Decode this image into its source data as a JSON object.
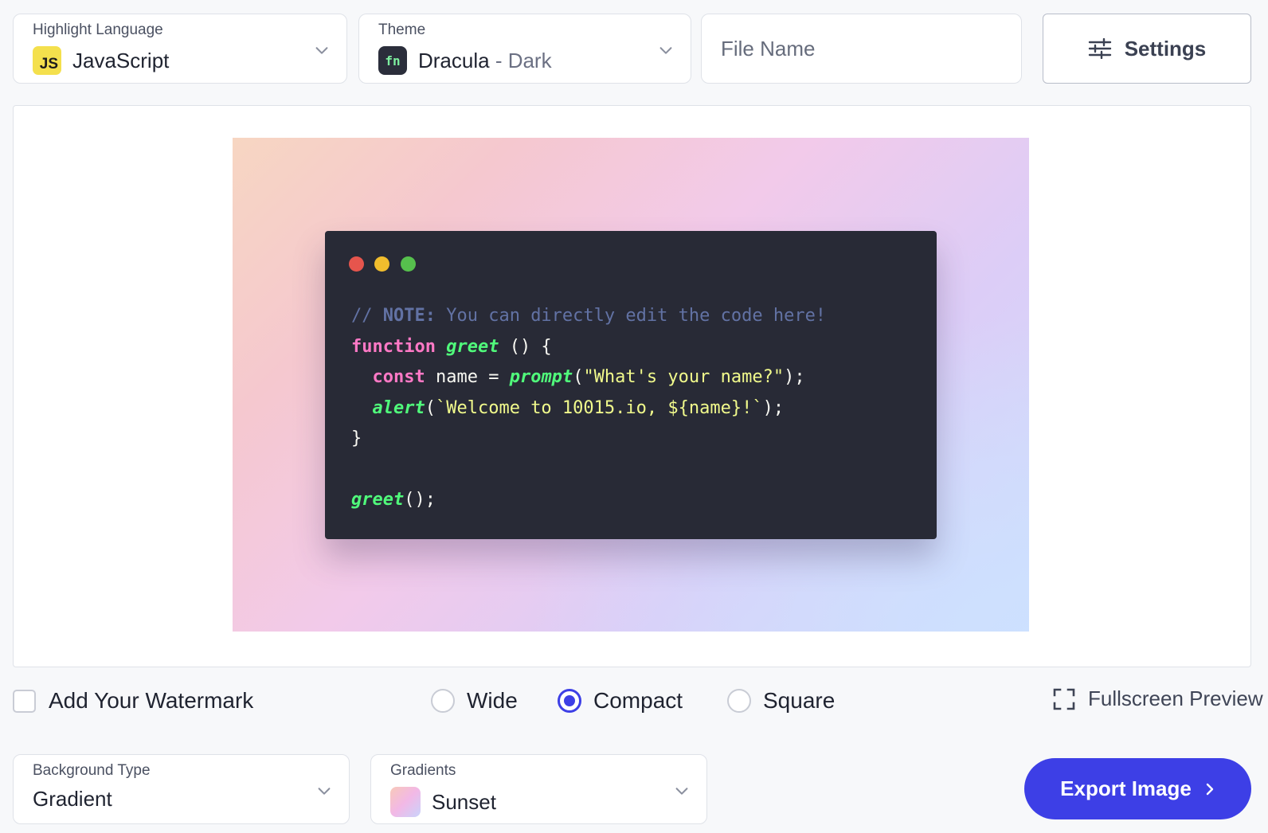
{
  "language": {
    "label": "Highlight Language",
    "value": "JavaScript",
    "badge": "JS"
  },
  "theme": {
    "label": "Theme",
    "name": "Dracula",
    "variant": " - Dark",
    "badge": "fn"
  },
  "file_name": {
    "placeholder": "File Name",
    "value": ""
  },
  "settings": {
    "label": "Settings"
  },
  "code": {
    "comment_prefix": "// ",
    "comment_note": "NOTE:",
    "comment_rest": " You can directly edit the code here!",
    "kw_function": "function",
    "fn_greet": "greet",
    "line1_rest": " () {",
    "indent": "  ",
    "kw_const": "const",
    "line2_mid": " name = ",
    "fn_prompt": "prompt",
    "paren_open": "(",
    "str_prompt": "\"What's your name?\"",
    "close_stmt": ");",
    "fn_alert": "alert",
    "str_alert": "`Welcome to 10015.io, ${name}!`",
    "brace_close": "}",
    "call_rest": "();"
  },
  "watermark": {
    "label": "Add Your Watermark",
    "checked": false
  },
  "sizes": {
    "wide": "Wide",
    "compact": "Compact",
    "square": "Square",
    "selected": "Compact"
  },
  "fullscreen": {
    "label": "Fullscreen Preview"
  },
  "background_type": {
    "label": "Background Type",
    "value": "Gradient"
  },
  "gradients": {
    "label": "Gradients",
    "value": "Sunset"
  },
  "export": {
    "label": "Export Image"
  },
  "colors": {
    "accent": "#3d3fe6",
    "code_bg": "#282a36"
  }
}
